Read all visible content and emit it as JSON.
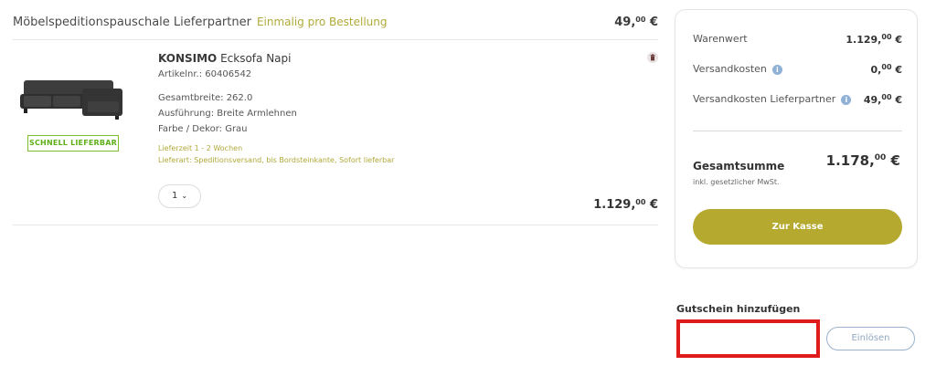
{
  "shipping_row": {
    "label": "Möbelspeditionspauschale Lieferpartner",
    "note": "Einmalig pro Bestellung",
    "price_main": "49,",
    "price_cents": "00",
    "price_currency": " €"
  },
  "item": {
    "brand": "KONSIMO",
    "name": " Ecksofa Napi",
    "article": "Artikelnr.: 60406542",
    "badge": "SCHNELL LIEFERBAR",
    "attributes": [
      "Gesamtbreite: 262.0",
      "Ausführung: Breite Armlehnen",
      "Farbe / Dekor: Grau"
    ],
    "delivery_time": "Lieferzeit 1 - 2 Wochen",
    "delivery_type": "Lieferart: Speditionsversand, bis Bordsteinkante, Sofort lieferbar",
    "quantity": "1",
    "total_main": "1.129,",
    "total_cents": "00",
    "total_currency": " €"
  },
  "summary": {
    "goods_label": "Warenwert",
    "goods_main": "1.129,",
    "goods_cents": "00",
    "goods_currency": " €",
    "shipping_label": "Versandkosten",
    "shipping_main": "0,",
    "shipping_cents": "00",
    "shipping_currency": " €",
    "partner_label": "Versandkosten Lieferpartner",
    "partner_main": "49,",
    "partner_cents": "00",
    "partner_currency": " €",
    "total_label": "Gesamtsumme",
    "total_main": "1.178,",
    "total_cents": "00",
    "total_currency": " €",
    "vat_note": "inkl. gesetzlicher MwSt.",
    "checkout_label": "Zur Kasse"
  },
  "voucher": {
    "title": "Gutschein hinzufügen",
    "placeholder": "",
    "redeem_label": "Einlösen"
  },
  "colors": {
    "accent": "#b5a92f",
    "badge_green": "#5fae1a",
    "highlight_red": "#e01b1b",
    "info_blue": "#8fb1d6"
  },
  "icons": {
    "info": "info-icon",
    "trash": "trash-icon",
    "chevron": "chevron-down-icon"
  }
}
